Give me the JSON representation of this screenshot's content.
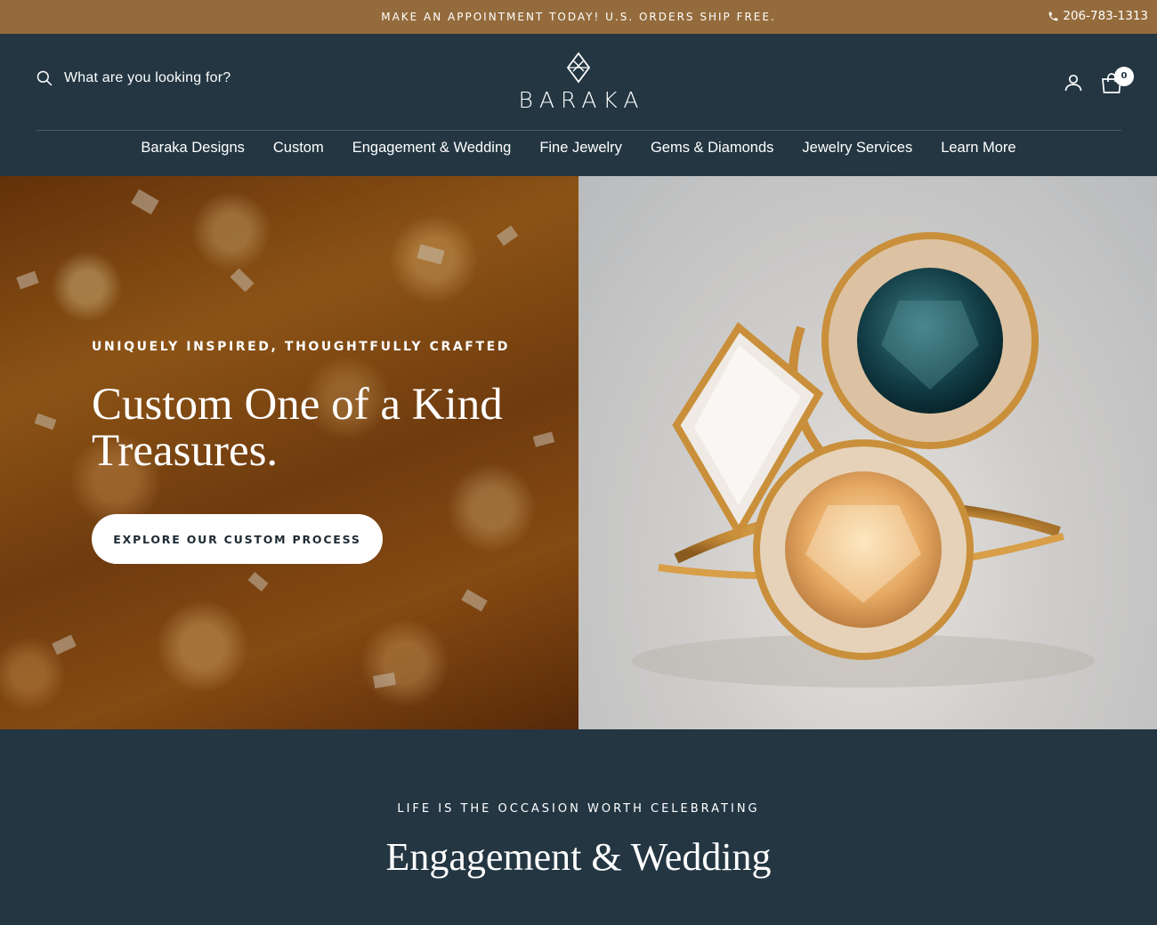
{
  "announcement": {
    "text": "MAKE AN APPOINTMENT TODAY! U.S. ORDERS SHIP FREE.",
    "phone": "206-783-1313",
    "phone_icon": "phone-icon"
  },
  "header": {
    "search_text": "What are you looking for?",
    "search_icon": "search-icon",
    "logo_text": "BARAKA",
    "account_icon": "user-icon",
    "cart_icon": "cart-icon",
    "cart_count": "0"
  },
  "nav": {
    "items": [
      {
        "label": "Baraka Designs"
      },
      {
        "label": "Custom"
      },
      {
        "label": "Engagement & Wedding"
      },
      {
        "label": "Fine Jewelry"
      },
      {
        "label": "Gems & Diamonds"
      },
      {
        "label": "Jewelry Services"
      },
      {
        "label": "Learn More"
      }
    ]
  },
  "hero": {
    "eyebrow": "UNIQUELY INSPIRED, THOUGHTFULLY CRAFTED",
    "headline_line1": "Custom One of a Kind",
    "headline_line2": "Treasures.",
    "cta_label": "EXPLORE OUR CUSTOM PROCESS"
  },
  "section": {
    "eyebrow": "LIFE IS THE OCCASION WORTH CELEBRATING",
    "title": "Engagement & Wedding"
  },
  "colors": {
    "announcement_bg": "#946b3c",
    "header_bg": "#233642",
    "accent": "#ffffff"
  }
}
